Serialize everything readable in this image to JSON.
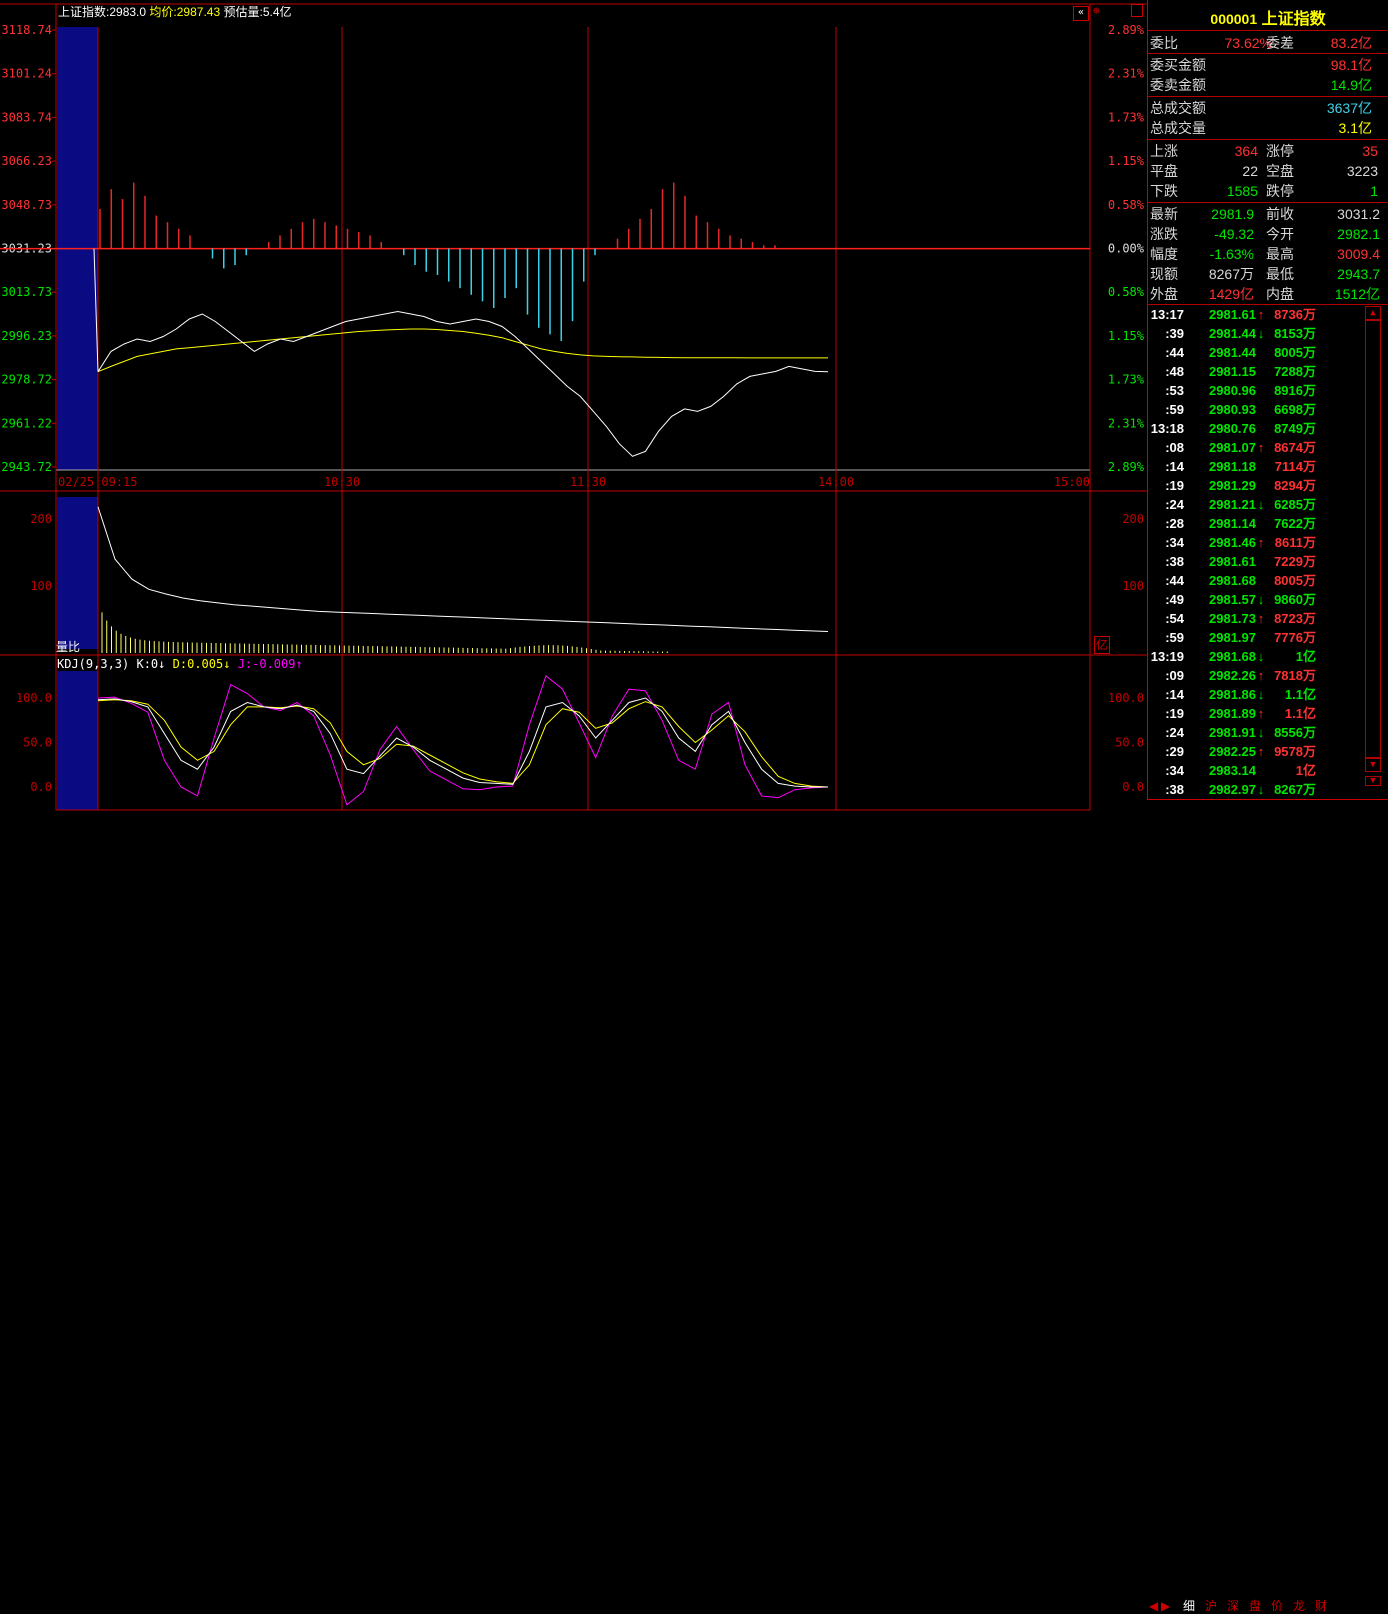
{
  "colors": {
    "up": "#ff3232",
    "down": "#00e600",
    "grid": "#c00000",
    "price_line": "#ffffff",
    "avg_line": "#ffff00",
    "kdj_k": "#ffffff",
    "kdj_d": "#ffff00",
    "kdj_j": "#ff00ff",
    "cyan": "#3cd2e6"
  },
  "header": {
    "name": "上证指数",
    "last_label": "2983.0",
    "avg_label": "均价:",
    "avg_value": "2987.43",
    "est_label": "预估量:",
    "est_value": "5.4亿",
    "collapse_icon": "double-chevron-left-icon"
  },
  "price_axis": {
    "left": [
      "3118.74",
      "3101.24",
      "3083.74",
      "3066.23",
      "3048.73",
      "3031.23",
      "3013.73",
      "2996.23",
      "2978.72",
      "2961.22",
      "2943.72"
    ],
    "right": [
      "2.89%",
      "2.31%",
      "1.73%",
      "1.15%",
      "0.58%",
      "0.00%",
      "0.58%",
      "1.15%",
      "1.73%",
      "2.31%",
      "2.89%"
    ]
  },
  "time_axis": [
    "02/25 09:15",
    "10:30",
    "11:30",
    "14:00",
    "15:00"
  ],
  "volume_axis": {
    "left": [
      "200",
      "100"
    ],
    "right": [
      "200",
      "100"
    ],
    "title": "量比",
    "unit": "亿"
  },
  "kdj": {
    "title": "KDJ(9,3,3)",
    "k": "K:0",
    "d": "D:0.005",
    "j": "J:-0.009",
    "axis_left": [
      "100.0",
      "50.0",
      "0.0"
    ],
    "axis_right": [
      "100.0",
      "50.0",
      "0.0"
    ]
  },
  "chart_data": {
    "type": "line",
    "prev_close": 3031.2,
    "ylim": [
      2943.72,
      3118.74
    ],
    "price": [
      2981.9,
      2990,
      2993,
      2995,
      2994,
      2996,
      2999,
      3003,
      3005,
      3002,
      2998,
      2994,
      2990,
      2993,
      2995,
      2994,
      2996,
      2998,
      3000,
      3002,
      3003,
      3004,
      3005,
      3006,
      3005,
      3004,
      3002,
      3001,
      3002,
      3003,
      3002,
      3000,
      2996,
      2991,
      2986,
      2981,
      2976,
      2972,
      2966,
      2960,
      2953,
      2948,
      2950,
      2958,
      2964,
      2967,
      2966,
      2968,
      2972,
      2977,
      2980,
      2981,
      2982,
      2984,
      2983,
      2982,
      2981.9
    ],
    "avg": [
      2981.9,
      2984,
      2986,
      2988,
      2989,
      2990,
      2991,
      2991.5,
      2992,
      2992.5,
      2993,
      2993.5,
      2994,
      2994.5,
      2995,
      2995.5,
      2996,
      2996.5,
      2997,
      2997.5,
      2998,
      2998.3,
      2998.6,
      2998.8,
      2999,
      2999,
      2998.8,
      2998.4,
      2998,
      2997.3,
      2996.5,
      2995.5,
      2994,
      2992.5,
      2991,
      2990,
      2989.2,
      2988.6,
      2988.2,
      2988,
      2987.9,
      2987.8,
      2987.7,
      2987.6,
      2987.55,
      2987.5,
      2987.5,
      2987.5,
      2987.45,
      2987.45,
      2987.43,
      2987.43,
      2987.43,
      2987.43,
      2987.43,
      2987.43,
      2987.43
    ],
    "bars": [
      12,
      18,
      15,
      20,
      16,
      10,
      8,
      6,
      4,
      0,
      -3,
      -6,
      -5,
      -2,
      0,
      2,
      4,
      6,
      8,
      9,
      8,
      7,
      6,
      5,
      4,
      2,
      0,
      -2,
      -5,
      -7,
      -8,
      -10,
      -12,
      -14,
      -16,
      -18,
      -15,
      -12,
      -20,
      -24,
      -26,
      -28,
      -22,
      -10,
      -2,
      0,
      3,
      6,
      9,
      12,
      18,
      20,
      16,
      10,
      8,
      6,
      4,
      3,
      2,
      1,
      1
    ],
    "volume_ratio": [
      218,
      140,
      110,
      95,
      88,
      82,
      78,
      75,
      72,
      70,
      68,
      66,
      64,
      62,
      61,
      60,
      59,
      58,
      57,
      56,
      55,
      54,
      53,
      52,
      51,
      50,
      49,
      48,
      47,
      46,
      45,
      44,
      43,
      42,
      41,
      40,
      39,
      38,
      37,
      36,
      35,
      34,
      33,
      32
    ],
    "kdj_k": [
      98,
      99,
      96,
      90,
      60,
      30,
      20,
      45,
      85,
      95,
      90,
      88,
      92,
      85,
      60,
      20,
      15,
      35,
      55,
      45,
      30,
      20,
      10,
      5,
      4,
      3,
      40,
      90,
      95,
      80,
      55,
      75,
      95,
      100,
      85,
      55,
      40,
      70,
      85,
      50,
      20,
      4,
      1,
      0,
      0
    ],
    "kdj_d": [
      97,
      98,
      97,
      93,
      75,
      45,
      30,
      40,
      70,
      90,
      90,
      89,
      91,
      88,
      72,
      40,
      25,
      32,
      48,
      46,
      36,
      26,
      16,
      9,
      6,
      4,
      25,
      70,
      88,
      84,
      66,
      72,
      88,
      96,
      90,
      68,
      50,
      64,
      80,
      62,
      34,
      12,
      4,
      1,
      0
    ],
    "kdj_j": [
      100,
      101,
      94,
      84,
      30,
      0,
      -10,
      55,
      115,
      105,
      90,
      86,
      95,
      80,
      36,
      -20,
      -5,
      42,
      68,
      42,
      18,
      8,
      -2,
      -3,
      0,
      1,
      70,
      125,
      110,
      72,
      33,
      80,
      110,
      108,
      75,
      30,
      20,
      82,
      95,
      25,
      -10,
      -12,
      -3,
      -1,
      0
    ]
  },
  "panel": {
    "code": "000001",
    "title": "上证指数",
    "rows1": [
      {
        "l": "委比",
        "v": "73.62%",
        "l2": "委差",
        "v2": "83.2亿"
      }
    ],
    "buy_label": "委买金额",
    "buy_val": "98.1亿",
    "sell_label": "委卖金额",
    "sell_val": "14.9亿",
    "total_amt_label": "总成交额",
    "total_amt_val": "3637亿",
    "total_vol_label": "总成交量",
    "total_vol_val": "3.1亿",
    "breadth": [
      {
        "l": "上涨",
        "v": "364",
        "l2": "涨停",
        "v2": "35"
      },
      {
        "l": "平盘",
        "v": "22",
        "l2": "空盘",
        "v2": "3223"
      },
      {
        "l": "下跌",
        "v": "1585",
        "l2": "跌停",
        "v2": "1"
      }
    ],
    "quote": [
      {
        "l": "最新",
        "v": "2981.9",
        "l2": "前收",
        "v2": "3031.2"
      },
      {
        "l": "涨跌",
        "v": "-49.32",
        "l2": "今开",
        "v2": "2982.1"
      },
      {
        "l": "幅度",
        "v": "-1.63%",
        "l2": "最高",
        "v2": "3009.4"
      },
      {
        "l": "现额",
        "v": "8267万",
        "l2": "最低",
        "v2": "2943.7"
      },
      {
        "l": "外盘",
        "v": "1429亿",
        "l2": "内盘",
        "v2": "1512亿"
      }
    ],
    "ticks": [
      {
        "t": "13:17",
        "p": "2981.61",
        "a": "↑",
        "v": "8736万"
      },
      {
        "t": ":39",
        "p": "2981.44",
        "a": "↓",
        "v": "8153万"
      },
      {
        "t": ":44",
        "p": "2981.44",
        "a": "",
        "v": "8005万"
      },
      {
        "t": ":48",
        "p": "2981.15",
        "a": "",
        "v": "7288万"
      },
      {
        "t": ":53",
        "p": "2980.96",
        "a": "",
        "v": "8916万"
      },
      {
        "t": ":59",
        "p": "2980.93",
        "a": "",
        "v": "6698万"
      },
      {
        "t": "13:18",
        "p": "2980.76",
        "a": "",
        "v": "8749万"
      },
      {
        "t": ":08",
        "p": "2981.07",
        "a": "↑",
        "v": "8674万"
      },
      {
        "t": ":14",
        "p": "2981.18",
        "a": "",
        "v": "7114万"
      },
      {
        "t": ":19",
        "p": "2981.29",
        "a": "",
        "v": "8294万"
      },
      {
        "t": ":24",
        "p": "2981.21",
        "a": "↓",
        "v": "6285万"
      },
      {
        "t": ":28",
        "p": "2981.14",
        "a": "",
        "v": "7622万"
      },
      {
        "t": ":34",
        "p": "2981.46",
        "a": "↑",
        "v": "8611万"
      },
      {
        "t": ":38",
        "p": "2981.61",
        "a": "",
        "v": "7229万"
      },
      {
        "t": ":44",
        "p": "2981.68",
        "a": "",
        "v": "8005万"
      },
      {
        "t": ":49",
        "p": "2981.57",
        "a": "↓",
        "v": "9860万"
      },
      {
        "t": ":54",
        "p": "2981.73",
        "a": "↑",
        "v": "8723万"
      },
      {
        "t": ":59",
        "p": "2981.97",
        "a": "",
        "v": "7776万"
      },
      {
        "t": "13:19",
        "p": "2981.68",
        "a": "↓",
        "v": "1亿"
      },
      {
        "t": ":09",
        "p": "2982.26",
        "a": "↑",
        "v": "7818万"
      },
      {
        "t": ":14",
        "p": "2981.86",
        "a": "↓",
        "v": "1.1亿"
      },
      {
        "t": ":19",
        "p": "2981.89",
        "a": "↑",
        "v": "1.1亿"
      },
      {
        "t": ":24",
        "p": "2981.91",
        "a": "↓",
        "v": "8556万"
      },
      {
        "t": ":29",
        "p": "2982.25",
        "a": "↑",
        "v": "9578万"
      },
      {
        "t": ":34",
        "p": "2983.14",
        "a": "",
        "v": "1亿"
      },
      {
        "t": ":38",
        "p": "2982.97",
        "a": "↓",
        "v": "8267万"
      }
    ],
    "tick_colors": [
      "up",
      "down",
      "down",
      "down",
      "down",
      "down",
      "down",
      "up",
      "up",
      "up",
      "down",
      "down",
      "up",
      "up",
      "up",
      "down",
      "up",
      "up",
      "down",
      "up",
      "down",
      "up",
      "down",
      "up",
      "up",
      "down"
    ],
    "tabs": [
      "细",
      "沪",
      "深",
      "盘",
      "价",
      "龙",
      "财"
    ]
  }
}
